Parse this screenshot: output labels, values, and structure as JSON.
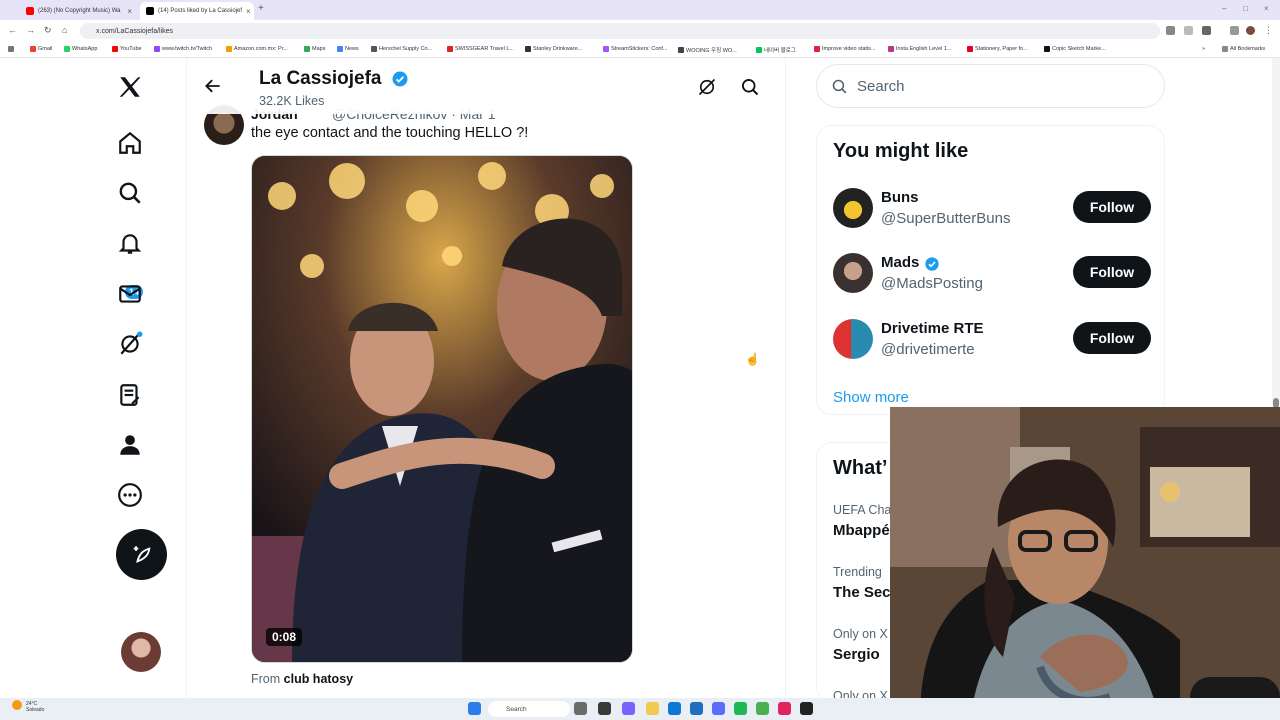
{
  "browser": {
    "tabs": [
      {
        "title": "(263) (No Copyright Music) Wa",
        "favicon_color": "#ff0000"
      },
      {
        "title": "(14) Posts liked by La Cassiojef",
        "favicon_color": "#000000"
      }
    ],
    "url": "x.com/LaCassiojefa/likes",
    "bookmarks": [
      {
        "label": "Gmail",
        "color": "#ea4335"
      },
      {
        "label": "WhatsApp",
        "color": "#25d366"
      },
      {
        "label": "YouTube",
        "color": "#ff0000"
      },
      {
        "label": "www.twitch.tv/Twitch",
        "color": "#9146ff"
      },
      {
        "label": "Amazon.com.mx: Pr...",
        "color": "#ff9900"
      },
      {
        "label": "Maps",
        "color": "#34a853"
      },
      {
        "label": "News",
        "color": "#4285f4"
      },
      {
        "label": "Herschel Supply Co...",
        "color": "#555555"
      },
      {
        "label": "SWISSGEAR Travel L...",
        "color": "#d62828"
      },
      {
        "label": "Stanley Drinkware...",
        "color": "#333333"
      },
      {
        "label": "StreamStickers: Conf...",
        "color": "#a855f7"
      },
      {
        "label": "WOOING 우징 WO...",
        "color": "#444444"
      },
      {
        "label": "네이버 블로그",
        "color": "#03c75a"
      },
      {
        "label": "Improve video statis...",
        "color": "#e11d48"
      },
      {
        "label": "Insta English Level 1...",
        "color": "#c13584"
      },
      {
        "label": "Stationery, Paper fo...",
        "color": "#e60023"
      },
      {
        "label": "Copic Sketch Marke...",
        "color": "#111111"
      }
    ],
    "all_bookmarks": "All Bookmarks"
  },
  "nav": {
    "notifications_count": "14"
  },
  "header": {
    "profile_name": "La Cassiojefa",
    "likes_count": "32.2K Likes"
  },
  "tweet": {
    "author": "Jordan",
    "handle": "@ChoiceReznikov · Mar 1",
    "text": "the eye contact and the touching HELLO ?!",
    "video_time": "0:08",
    "from_prefix": "From ",
    "from_name": "club hatosy"
  },
  "sidebar": {
    "search_placeholder": "Search",
    "wtf_title": "You might like",
    "suggestions": [
      {
        "name": "Buns",
        "handle": "@SuperButterBuns",
        "button": "Follow"
      },
      {
        "name": "Mads",
        "handle": "@MadsPosting",
        "button": "Follow"
      },
      {
        "name": "Drivetime RTE",
        "handle": "@drivetimerte",
        "button": "Follow"
      }
    ],
    "show_more": "Show more",
    "trends_title": "What’",
    "trends": [
      {
        "meta": "UEFA Cha",
        "name": "Mbappé"
      },
      {
        "meta": "Trending",
        "name": "The Sec"
      },
      {
        "meta": "Only on X",
        "name": "Sergio"
      },
      {
        "meta": "Only on X",
        "name": ""
      }
    ]
  },
  "taskbar": {
    "weather_temp": "24°C",
    "weather_desc": "Soleado",
    "search_label": "Search"
  },
  "colors": {
    "accent": "#1d9bf0",
    "text_primary": "#0f1419",
    "text_secondary": "#536471"
  }
}
